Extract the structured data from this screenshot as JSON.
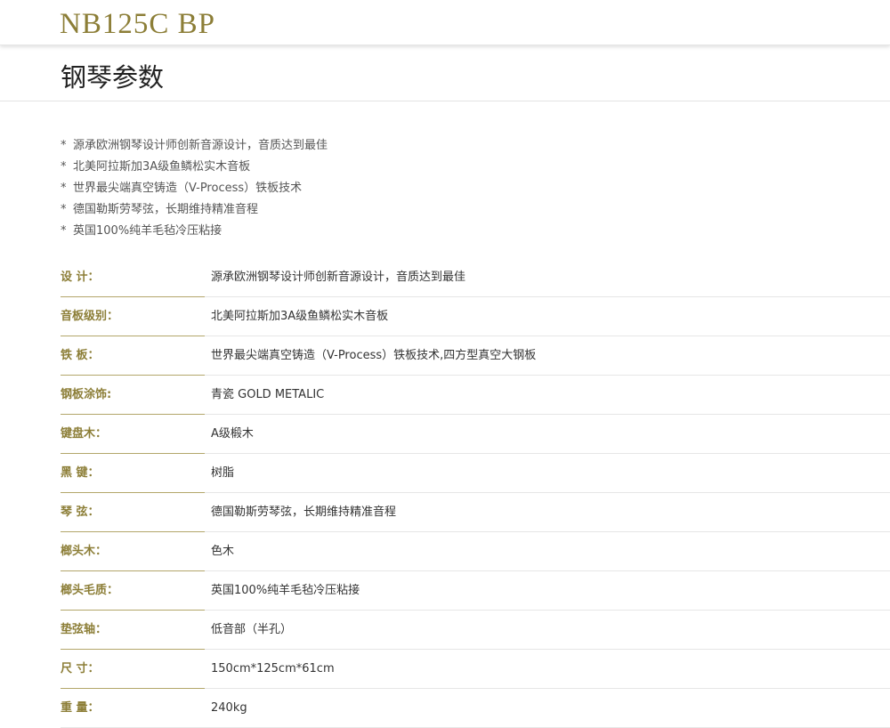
{
  "header": {
    "model": "NB125C BP"
  },
  "section": {
    "title": "钢琴参数"
  },
  "features": {
    "bullet": "*",
    "items": [
      "源承欧洲钢琴设计师创新音源设计，音质达到最佳",
      "北美阿拉斯加3A级鱼鳞松实木音板",
      "世界最尖端真空铸造（V-Process）铁板技术",
      "德国勒斯劳琴弦，长期维持精准音程",
      "英国100%纯羊毛毡冷压粘接"
    ]
  },
  "specs": [
    {
      "label": "设 计：",
      "value": "源承欧洲钢琴设计师创新音源设计，音质达到最佳"
    },
    {
      "label": "音板级别：",
      "value": "北美阿拉斯加3A级鱼鳞松实木音板"
    },
    {
      "label": "铁 板：",
      "value": "世界最尖端真空铸造（V-Process）铁板技术,四方型真空大钢板"
    },
    {
      "label": "钢板涂饰:",
      "value": "青瓷 GOLD METALIC"
    },
    {
      "label": "键盘木：",
      "value": "A级椴木"
    },
    {
      "label": "黑 键：",
      "value": "树脂"
    },
    {
      "label": "琴 弦：",
      "value": "德国勒斯劳琴弦，长期维持精准音程"
    },
    {
      "label": "榔头木：",
      "value": "色木"
    },
    {
      "label": "榔头毛质：",
      "value": "英国100%纯羊毛毡冷压粘接"
    },
    {
      "label": "垫弦轴：",
      "value": "低音部（半孔）"
    },
    {
      "label": "尺 寸：",
      "value": "150cm*125cm*61cm"
    },
    {
      "label": "重 量：",
      "value": "240kg"
    }
  ],
  "colors": {
    "accent": "#8c7e37",
    "divider_accent": "#b3a66a",
    "text": "#333333"
  }
}
